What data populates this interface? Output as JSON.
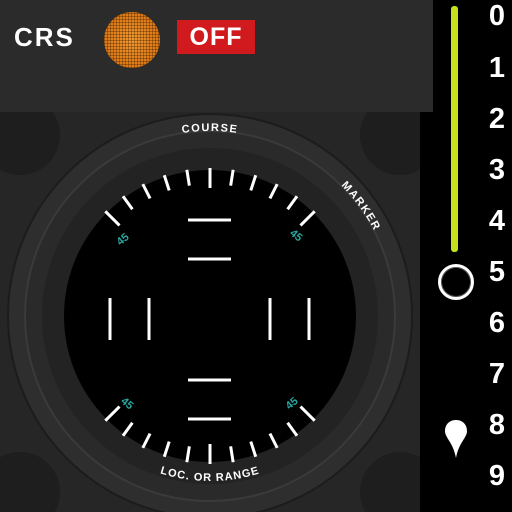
{
  "header": {
    "label": "CRS",
    "off_button": "OFF",
    "lamp_color": "#e07a10",
    "off_color": "#d01a1e"
  },
  "instrument": {
    "course_label": "COURSE",
    "marker_label": "MARKER",
    "bottom_label": "LOC. OR RANGE",
    "angle_labels": [
      "45",
      "45",
      "45",
      "45"
    ]
  },
  "scale": {
    "numbers": [
      "0",
      "1",
      "2",
      "3",
      "4",
      "5",
      "6",
      "7",
      "8",
      "9"
    ],
    "bar_color": "#c6e21a",
    "current_value": 5
  }
}
